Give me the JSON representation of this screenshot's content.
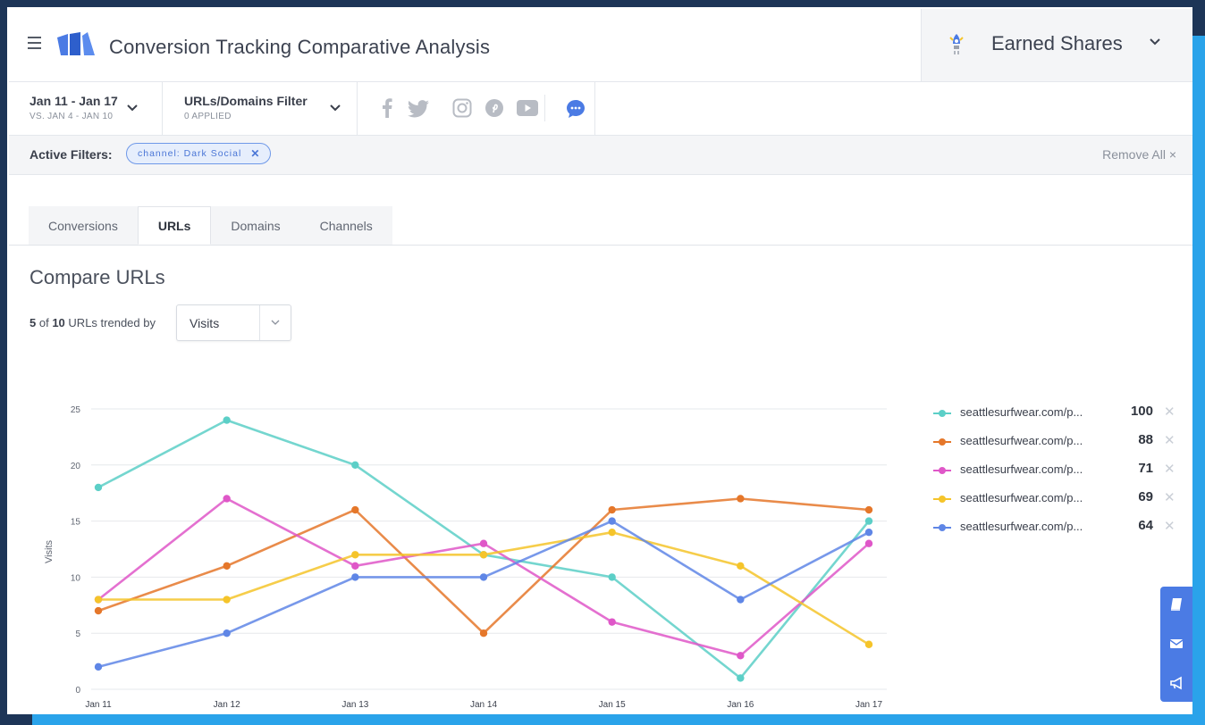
{
  "header": {
    "title": "Conversion Tracking Comparative Analysis",
    "account_name": "Earned Shares"
  },
  "toolbar": {
    "date_range": "Jan 11 - Jan 17",
    "date_compare": "VS. JAN 4 - JAN 10",
    "url_filter_label": "URLs/Domains Filter",
    "url_filter_status": "0 APPLIED",
    "social_icons": [
      "facebook-icon",
      "twitter-icon",
      "instagram-icon",
      "pinterest-icon",
      "youtube-icon",
      "dark-social-icon"
    ]
  },
  "filters": {
    "label": "Active Filters:",
    "chip": "channel: Dark Social",
    "remove_all": "Remove All ×"
  },
  "tabs": [
    {
      "label": "Conversions",
      "active": false
    },
    {
      "label": "URLs",
      "active": true
    },
    {
      "label": "Domains",
      "active": false
    },
    {
      "label": "Channels",
      "active": false
    }
  ],
  "compare": {
    "title": "Compare URLs",
    "count_shown": "5",
    "of_text": "of",
    "count_total": "10",
    "trend_text": "URLs trended by",
    "metric": "Visits"
  },
  "chart_data": {
    "type": "line",
    "xlabel": "",
    "ylabel": "Visits",
    "categories": [
      "Jan 11",
      "Jan 12",
      "Jan 13",
      "Jan 14",
      "Jan 15",
      "Jan 16",
      "Jan 17"
    ],
    "ylim": [
      0,
      25
    ],
    "yticks": [
      0,
      5,
      10,
      15,
      20,
      25
    ],
    "grid": true,
    "legend_position": "right",
    "series": [
      {
        "name": "seattlesurfwear.com/p...",
        "total": "100",
        "color": "#5ccfc7",
        "values": [
          18,
          24,
          20,
          12,
          10,
          1,
          15
        ]
      },
      {
        "name": "seattlesurfwear.com/p...",
        "total": "88",
        "color": "#e5772a",
        "values": [
          7,
          11,
          16,
          5,
          16,
          17,
          16
        ]
      },
      {
        "name": "seattlesurfwear.com/p...",
        "total": "71",
        "color": "#df57c8",
        "values": [
          8,
          17,
          11,
          13,
          6,
          3,
          13
        ]
      },
      {
        "name": "seattlesurfwear.com/p...",
        "total": "69",
        "color": "#f5c42a",
        "values": [
          8,
          8,
          12,
          12,
          14,
          11,
          4
        ]
      },
      {
        "name": "seattlesurfwear.com/p...",
        "total": "64",
        "color": "#5f86e6",
        "values": [
          2,
          5,
          10,
          10,
          15,
          8,
          14
        ]
      }
    ]
  },
  "legend_close": "✕",
  "side_widget_icons": [
    "book-icon",
    "mail-icon",
    "megaphone-icon"
  ]
}
